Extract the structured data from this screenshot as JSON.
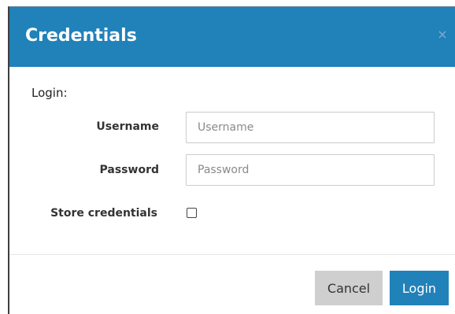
{
  "dialog": {
    "title": "Credentials",
    "close_icon": "×"
  },
  "form": {
    "section_label": "Login:",
    "username": {
      "label": "Username",
      "placeholder": "Username",
      "value": ""
    },
    "password": {
      "label": "Password",
      "placeholder": "Password",
      "value": ""
    },
    "store_credentials": {
      "label": "Store credentials",
      "checked": false
    }
  },
  "footer": {
    "cancel_label": "Cancel",
    "login_label": "Login"
  },
  "colors": {
    "header_bg": "#2181b9",
    "primary_button": "#2181b9",
    "secondary_button": "#cfcfcf"
  }
}
